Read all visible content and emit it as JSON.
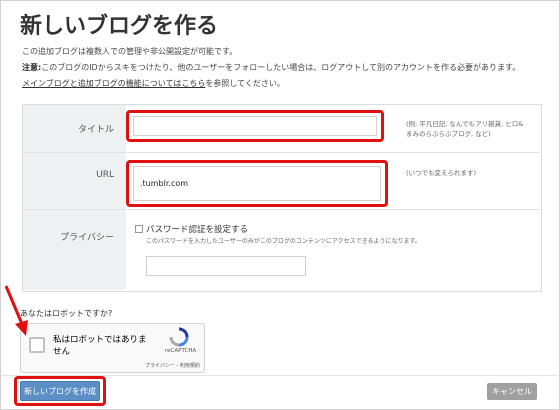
{
  "page": {
    "title": "新しいブログを作る",
    "intro_line1": "この追加ブログは複数人での管理や非公開設定が可能です。",
    "intro_note_label": "注意:",
    "intro_line2": "このブログのIDからスキをつけたり、他のユーザーをフォローしたい場合は、ログアウトして別のアカウントを作る必要があります。",
    "intro_link": "メインブログと追加ブログの機能についてはこちら",
    "intro_line3_tail": "を参照してください。"
  },
  "form": {
    "title_label": "タイトル",
    "title_value": "",
    "title_hint": "(例: 平凡日記, なんでもアリ雑貨, ヒロ&まみのらぶらぶブログ, など)",
    "url_label": "URL",
    "url_value": ".tumblr.com",
    "url_hint": "(いつでも変えられます)",
    "privacy_label": "プライバシー",
    "privacy_checkbox_label": "パスワード認証を設定する",
    "privacy_desc": "このパスワードを入力したユーザーのみがこのブログのコンテンツにアクセスできるようになります。",
    "privacy_checked": false,
    "password_value": ""
  },
  "captcha": {
    "question": "あなたはロボットですか?",
    "checkbox_label": "私はロボットではありません",
    "brand": "reCAPTCHA",
    "links": "プライバシー - 利用規約"
  },
  "actions": {
    "create_label": "新しいブログを作成",
    "cancel_label": "キャンセル"
  },
  "colors": {
    "highlight": "#e01010",
    "primary_button": "#5d8fc7",
    "cancel_button": "#a0a0a0"
  }
}
